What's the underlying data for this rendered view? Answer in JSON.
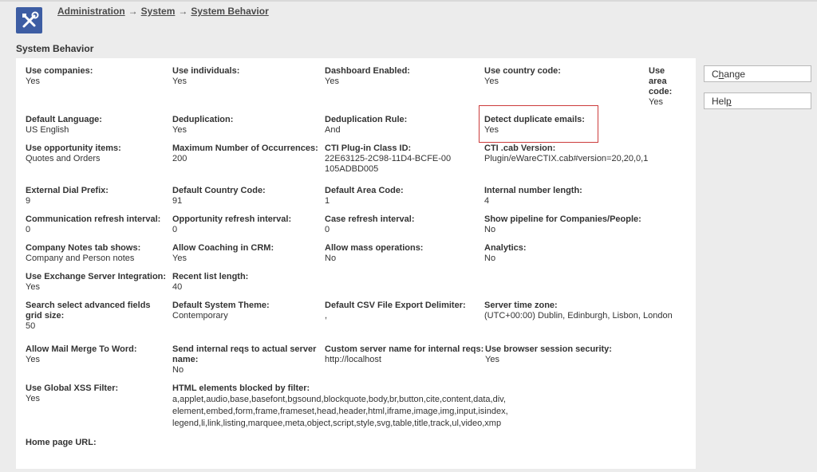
{
  "breadcrumb": {
    "items": [
      "Administration",
      "System",
      "System Behavior"
    ],
    "separator": "→"
  },
  "page_title": "System Behavior",
  "buttons": {
    "change": {
      "pre": "C",
      "u": "h",
      "post": "ange"
    },
    "help": {
      "pre": "Hel",
      "u": "p",
      "post": ""
    }
  },
  "fields": {
    "use_companies": {
      "label": "Use companies:",
      "value": "Yes"
    },
    "use_individuals": {
      "label": "Use individuals:",
      "value": "Yes"
    },
    "dashboard_enabled": {
      "label": "Dashboard Enabled:",
      "value": "Yes"
    },
    "use_country_code": {
      "label": "Use country code:",
      "value": "Yes"
    },
    "use_area_code": {
      "label": "Use area code:",
      "value": "Yes"
    },
    "default_language": {
      "label": "Default Language:",
      "value": "US English"
    },
    "deduplication": {
      "label": "Deduplication:",
      "value": "Yes"
    },
    "deduplication_rule": {
      "label": "Deduplication Rule:",
      "value": "And"
    },
    "detect_duplicate_emails": {
      "label": "Detect duplicate emails:",
      "value": "Yes"
    },
    "use_opportunity_items": {
      "label": "Use opportunity items:",
      "value": "Quotes and Orders"
    },
    "max_occurrences": {
      "label": "Maximum Number of Occurrences:",
      "value": "200"
    },
    "cti_plugin_class_id": {
      "label": "CTI Plug-in Class ID:",
      "value": "22E63125-2C98-11D4-BCFE-00105ADBD005"
    },
    "cti_cab_version": {
      "label": "CTI .cab Version:",
      "value": "Plugin/eWareCTIX.cab#version=20,20,0,1"
    },
    "external_dial_prefix": {
      "label": "External Dial Prefix:",
      "value": "9"
    },
    "default_country_code": {
      "label": "Default Country Code:",
      "value": "91"
    },
    "default_area_code": {
      "label": "Default Area Code:",
      "value": "1"
    },
    "internal_number_length": {
      "label": "Internal number length:",
      "value": "4"
    },
    "communication_refresh": {
      "label": "Communication refresh interval:",
      "value": "0"
    },
    "opportunity_refresh": {
      "label": "Opportunity refresh interval:",
      "value": "0"
    },
    "case_refresh": {
      "label": "Case refresh interval:",
      "value": "0"
    },
    "show_pipeline": {
      "label": "Show pipeline for Companies/People:",
      "value": "No"
    },
    "company_notes_tab": {
      "label": "Company Notes tab shows:",
      "value": "Company and Person notes"
    },
    "allow_coaching": {
      "label": "Allow Coaching in CRM:",
      "value": "Yes"
    },
    "allow_mass_operations": {
      "label": "Allow mass operations:",
      "value": "No"
    },
    "analytics": {
      "label": "Analytics:",
      "value": "No"
    },
    "use_exchange_server": {
      "label": "Use Exchange Server Integration:",
      "value": "Yes"
    },
    "recent_list_length": {
      "label": "Recent list length:",
      "value": "40"
    },
    "search_select_grid_size": {
      "label": "Search select advanced fields grid size:",
      "value": "50"
    },
    "default_system_theme": {
      "label": "Default System Theme:",
      "value": "Contemporary"
    },
    "default_csv_delimiter": {
      "label": "Default CSV File Export Delimiter:",
      "value": ","
    },
    "server_time_zone": {
      "label": "Server time zone:",
      "value": "(UTC+00:00) Dublin, Edinburgh, Lisbon, London"
    },
    "allow_mail_merge": {
      "label": "Allow Mail Merge To Word:",
      "value": "Yes"
    },
    "send_internal_reqs": {
      "label": "Send internal reqs to actual server name:",
      "value": "No"
    },
    "custom_server_name": {
      "label": "Custom server name for internal reqs:",
      "value": "http://localhost"
    },
    "use_browser_session_security": {
      "label": "Use browser session security:",
      "value": "Yes"
    },
    "use_global_xss_filter": {
      "label": "Use Global XSS Filter:",
      "value": "Yes"
    },
    "html_elements_blocked": {
      "label": "HTML elements blocked by filter:",
      "value": "a,applet,audio,base,basefont,bgsound,blockquote,body,br,button,cite,content,data,div,element,embed,form,frame,frameset,head,header,html,iframe,image,img,input,isindex,legend,li,link,listing,marquee,meta,object,script,style,svg,table,title,track,ul,video,xmp"
    },
    "home_page_url": {
      "label": "Home page URL:",
      "value": ""
    }
  }
}
